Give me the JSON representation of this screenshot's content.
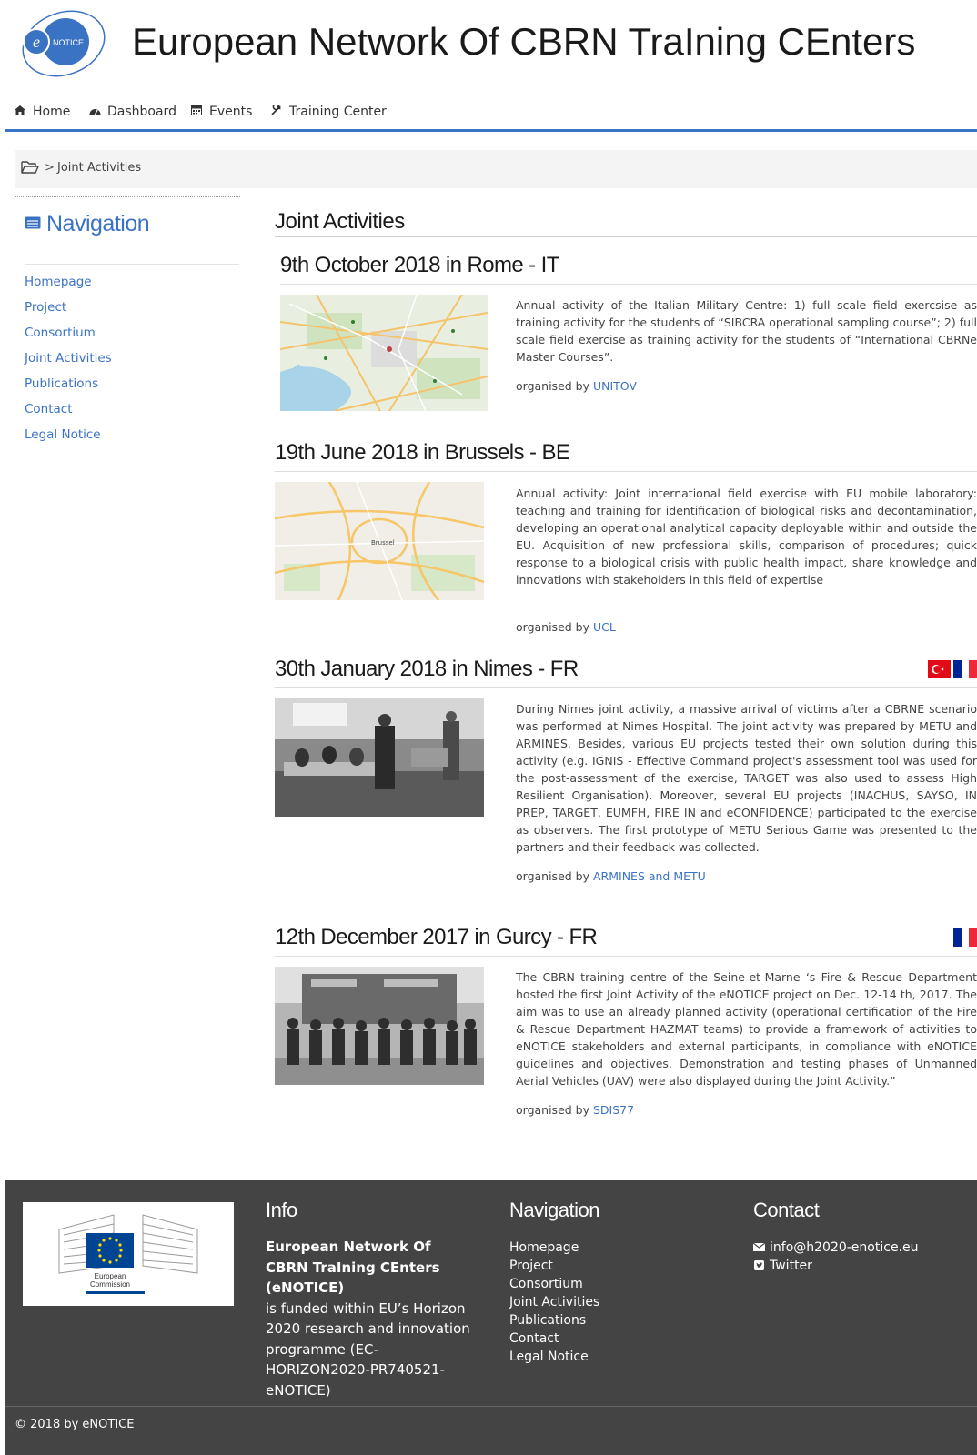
{
  "site": {
    "logo_text": "NOTICE",
    "logo_letter": "e",
    "title": "European Network Of CBRN TraIning CEnters"
  },
  "topnav": [
    {
      "label": "Home",
      "icon": "home-icon"
    },
    {
      "label": "Dashboard",
      "icon": "dashboard-icon"
    },
    {
      "label": "Events",
      "icon": "calendar-icon"
    },
    {
      "label": "Training Center",
      "icon": "wrench-icon"
    }
  ],
  "breadcrumb": {
    "separator": ">",
    "current": "Joint Activities"
  },
  "sidebar": {
    "title": "Navigation",
    "items": [
      "Homepage",
      "Project",
      "Consortium",
      "Joint Activities",
      "Publications",
      "Contact",
      "Legal Notice"
    ]
  },
  "main": {
    "title": "Joint Activities",
    "events": [
      {
        "title": "9th October 2018 in Rome - IT",
        "description": "Annual activity of the Italian Military Centre: 1) full scale field exercsise as training activity for the students of “SIBCRA operational sampling course”; 2) full scale field exercise as training activity for the students of “International CBRNe Master Courses”.",
        "organised_label": "organised by",
        "organiser": "UNITOV",
        "image": "map-rome"
      },
      {
        "title": "19th June 2018 in Brussels - BE",
        "description": "Annual activity: Joint international field exercise with EU mobile laboratory: teaching and training for identification of biological risks and decontamination, developing an operational analytical capacity deployable within and outside the EU. Acquisition of new professional skills, comparison of procedures; quick response to a biological crisis with public health impact, share knowledge and innovations with stakeholders in this field of expertise",
        "organised_label": "organised by",
        "organiser": "UCL",
        "image": "map-brussels",
        "map_label": "Brussel"
      },
      {
        "title": "30th January 2018 in Nimes - FR",
        "description": "During Nimes joint activity, a massive arrival of victims after a CBRNE scenario was performed at Nimes Hospital. The joint activity was prepared by METU and ARMINES. Besides, various EU projects tested their own solution during this activity (e.g. IGNIS - Effective Command project's assessment tool was used for the post-assessment of the exercise, TARGET was also used to assess High Resilient Organisation). Moreover, several EU projects (INACHUS, SAYSO, IN PREP, TARGET, EUMFH, FIRE IN and eCONFIDENCE) participated to the exercise as observers. The first prototype of METU Serious Game was presented to the partners and their feedback was collected.",
        "organised_label": "organised by",
        "organiser": "ARMINES and METU",
        "image": "photo-nimes",
        "flags": [
          "turkey-flag",
          "france-flag"
        ]
      },
      {
        "title": "12th December 2017 in Gurcy - FR",
        "description": "The CBRN training centre of the Seine-et-Marne ‘s Fire & Rescue Department hosted the first Joint Activity of the eNOTICE project on Dec. 12-14 th, 2017. The aim was to use an already planned activity (operational certification of the Fire & Rescue Department HAZMAT teams) to provide a framework of activities to eNOTICE stakeholders and external participants, in compliance with eNOTICE guidelines and objectives. Demonstration and testing phases of Unmanned Aerial Vehicles (UAV) were also displayed during the Joint Activity.”",
        "organised_label": "organised by",
        "organiser": "SDIS77",
        "image": "photo-gurcy",
        "flags": [
          "france-flag"
        ]
      }
    ]
  },
  "footer": {
    "ec_logo_text": [
      "European",
      "Commission"
    ],
    "info": {
      "title": "Info",
      "bold": "European Network Of CBRN TraIning CEnters (eNOTICE)",
      "text": "is funded within EU’s Horizon 2020 research and innovation programme (EC-HORIZON2020-PR740521-eNOTICE)"
    },
    "navigation": {
      "title": "Navigation",
      "items": [
        "Homepage",
        "Project",
        "Consortium",
        "Joint Activities",
        "Publications",
        "Contact",
        "Legal Notice"
      ]
    },
    "contact": {
      "title": "Contact",
      "email": "info@h2020-enotice.eu",
      "twitter": "Twitter"
    },
    "copyright": "© 2018 by eNOTICE"
  },
  "colors": {
    "accent": "#3b73c4",
    "footer_bg": "#444444",
    "breadcrumb_bg": "#f4f4f4"
  }
}
